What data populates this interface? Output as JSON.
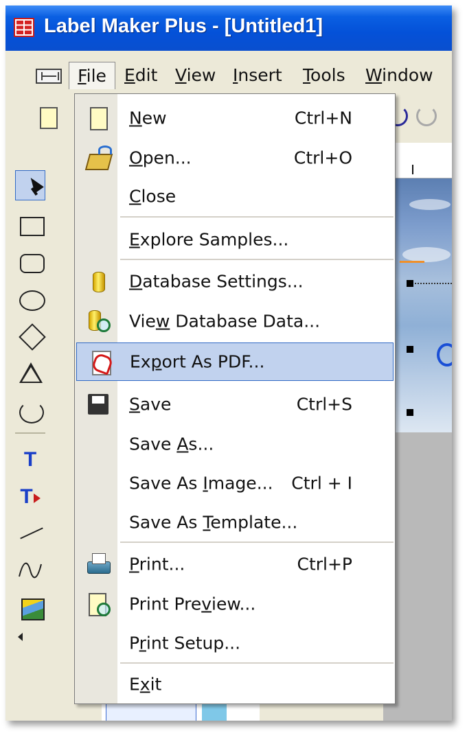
{
  "window": {
    "title": "Label Maker Plus - [Untitled1]",
    "app_icon": "label-maker-app-icon"
  },
  "menubar": {
    "items": [
      {
        "label": "File",
        "mnemonic": "F",
        "active": true
      },
      {
        "label": "Edit",
        "mnemonic": "E"
      },
      {
        "label": "View",
        "mnemonic": "V"
      },
      {
        "label": "Insert",
        "mnemonic": "I"
      },
      {
        "label": "Tools",
        "mnemonic": "T"
      },
      {
        "label": "Window",
        "mnemonic": "W"
      }
    ]
  },
  "file_menu": {
    "items": [
      {
        "label": "New",
        "shortcut": "Ctrl+N",
        "icon": "new-document-icon"
      },
      {
        "label": "Open...",
        "shortcut": "Ctrl+O",
        "icon": "open-folder-icon"
      },
      {
        "label": "Close"
      },
      {
        "label": "Explore Samples..."
      },
      {
        "label": "Database Settings...",
        "icon": "database-icon"
      },
      {
        "label": "View Database Data...",
        "icon": "view-database-icon"
      },
      {
        "label": "Export As PDF...",
        "icon": "pdf-icon",
        "highlighted": true
      },
      {
        "label": "Save",
        "shortcut": "Ctrl+S",
        "icon": "save-disk-icon"
      },
      {
        "label": "Save As..."
      },
      {
        "label": "Save As Image...",
        "shortcut": "Ctrl + I"
      },
      {
        "label": "Save As Template..."
      },
      {
        "label": "Print...",
        "shortcut": "Ctrl+P",
        "icon": "printer-icon"
      },
      {
        "label": "Print Preview...",
        "icon": "print-preview-icon"
      },
      {
        "label": "Print Setup..."
      },
      {
        "label": "Exit"
      }
    ]
  },
  "tools": [
    "select-arrow-icon",
    "rectangle-icon",
    "rounded-rectangle-icon",
    "ellipse-icon",
    "diamond-icon",
    "triangle-icon",
    "pie-shape-icon",
    "text-icon",
    "text-style-icon",
    "line-icon",
    "curve-icon",
    "image-icon"
  ],
  "colors": {
    "titlebar": "#0a5fe2",
    "menu_highlight": "#c1d2ee",
    "menu_highlight_border": "#316ac5",
    "chrome": "#ece9d8",
    "tool_text": "#1a3fc8"
  }
}
